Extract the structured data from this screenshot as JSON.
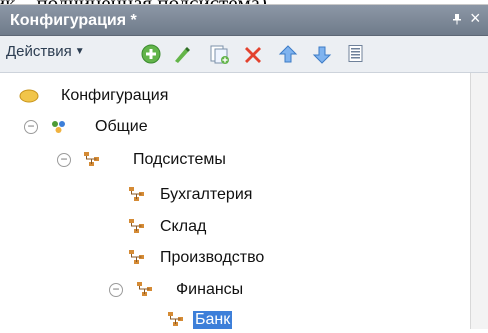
{
  "caption_text": "ик – подчинённая подсистема).",
  "window": {
    "title": "Конфигурация *"
  },
  "toolbar": {
    "actions_label": "Действия",
    "icons": [
      "add-icon",
      "edit-icon",
      "copy-icon",
      "delete-icon",
      "move-up-icon",
      "move-down-icon",
      "list-icon"
    ]
  },
  "tree": {
    "root": "Конфигурация",
    "common": "Общие",
    "subsystems": "Подсистемы",
    "items": [
      "Бухгалтерия",
      "Склад",
      "Производство",
      "Финансы"
    ],
    "bank": "Банк"
  },
  "colors": {
    "titlebar": "#7f8a99",
    "toolbar": "#eceff3",
    "selection": "#3d7fd9"
  }
}
